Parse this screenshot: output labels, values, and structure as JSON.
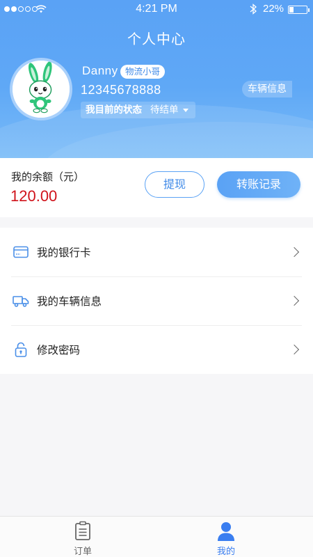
{
  "status_bar": {
    "time": "4:21 PM",
    "battery_percent": "22%",
    "battery_level": 0.22,
    "signal_bars": 2
  },
  "header": {
    "title": "个人中心",
    "username": "Danny",
    "role_badge": "物流小哥",
    "phone": "12345678888",
    "status_label": "我目前的状态",
    "status_value": "待结单",
    "vehicle_info_button": "车辆信息"
  },
  "balance": {
    "label": "我的余额（元）",
    "amount": "120.00",
    "withdraw_button": "提现",
    "transfer_records_button": "转账记录"
  },
  "menu": {
    "items": [
      {
        "label": "我的银行卡",
        "icon": "credit-card-icon"
      },
      {
        "label": "我的车辆信息",
        "icon": "truck-icon"
      },
      {
        "label": "修改密码",
        "icon": "lock-icon"
      }
    ]
  },
  "tabbar": {
    "tabs": [
      {
        "label": "订单",
        "icon": "clipboard-icon",
        "active": false
      },
      {
        "label": "我的",
        "icon": "user-icon",
        "active": true
      }
    ]
  },
  "colors": {
    "accent": "#5aa2f5",
    "amount": "#d0131b",
    "active_tab": "#3a7ef0"
  }
}
